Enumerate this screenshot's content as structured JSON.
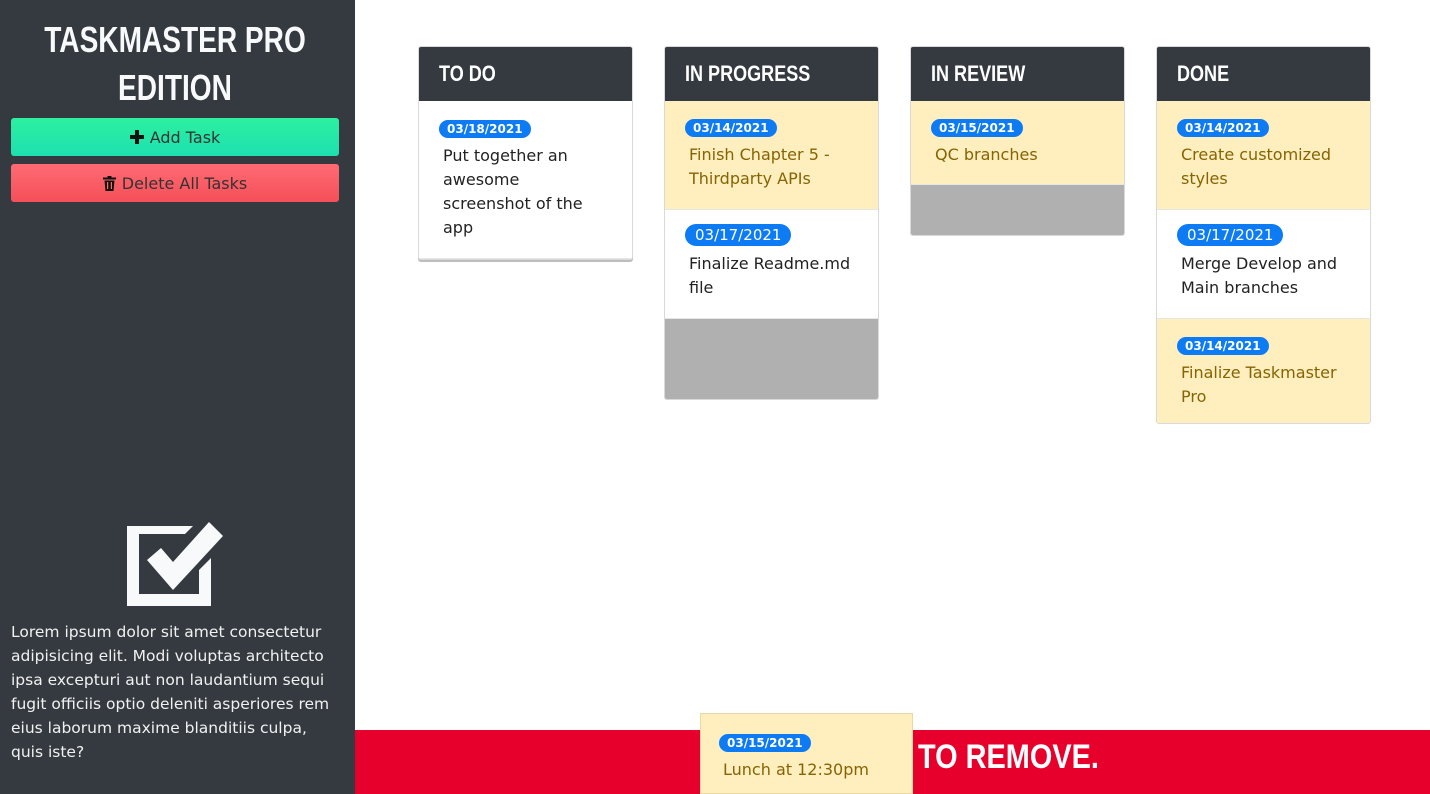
{
  "app": {
    "title": "Taskmaster Pro Edition",
    "add_task_label": "Add Task",
    "delete_all_label": "Delete All Tasks",
    "description": "Lorem ipsum dolor sit amet consectetur adipisicing elit. Modi voluptas architecto ipsa excepturi aut non laudantium sequi fugit officiis optio deleniti asperiores rem eius laborum maxime blanditiis culpa, quis iste?"
  },
  "colors": {
    "sidebar": "#343a40",
    "add_button": "#2cf0a0",
    "delete_button": "#f54f58",
    "badge": "#0d7bf4",
    "warning_task": "#ffeebe",
    "trash_zone": "#e8002c"
  },
  "columns": [
    {
      "title": "To Do",
      "tasks": [
        {
          "date": "03/18/2021",
          "text": "Put together an awesome screenshot of the app",
          "style": "plain"
        }
      ]
    },
    {
      "title": "In Progress",
      "tasks": [
        {
          "date": "03/14/2021",
          "text": "Finish Chapter 5 - Thirdparty APIs",
          "style": "warning"
        },
        {
          "date": "03/17/2021",
          "text": "Finalize Readme.md file",
          "style": "plain"
        }
      ]
    },
    {
      "title": "In Review",
      "tasks": [
        {
          "date": "03/15/2021",
          "text": "QC branches",
          "style": "warning"
        }
      ]
    },
    {
      "title": "Done",
      "tasks": [
        {
          "date": "03/14/2021",
          "text": "Create customized styles",
          "style": "warning"
        },
        {
          "date": "03/17/2021",
          "text": "Merge Develop and Main branches",
          "style": "plain"
        },
        {
          "date": "03/14/2021",
          "text": "Finalize Taskmaster Pro",
          "style": "warning"
        }
      ]
    }
  ],
  "trash": {
    "label_visible": "to remove."
  },
  "dragged_task": {
    "date": "03/15/2021",
    "text": "Lunch at 12:30pm"
  }
}
